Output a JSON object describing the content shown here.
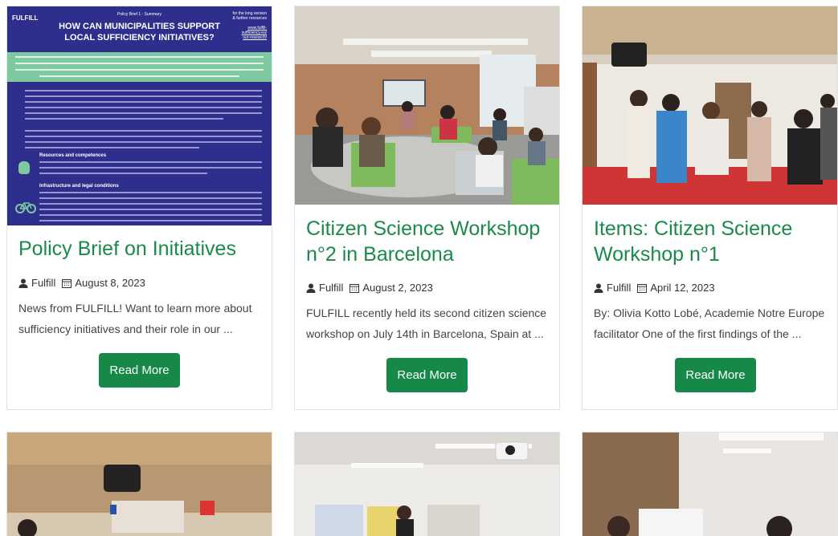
{
  "cards": [
    {
      "title": "Policy Brief on Initiatives",
      "author": "Fulfill",
      "date": "August 8, 2023",
      "excerpt": "News from FULFILL! Want to learn more about sufficiency initiatives and their role in our ...",
      "button": "Read More",
      "image": {
        "logo": "FULFILL",
        "subtitle": "Policy Brief 1 - Summary",
        "heading_line1": "HOW CAN MUNICIPALITIES SUPPORT",
        "heading_line2": "LOCAL SUFFICIENCY INITIATIVES?",
        "link_line1": "for the long version",
        "link_line2": "& further resources",
        "link_line3": "www.fulfill-",
        "link_line4": "sufficiency.eu/",
        "link_line5": "our-research/",
        "section1": "Resources and competences",
        "section2": "Infrastructure and legal conditions"
      }
    },
    {
      "title": "Citizen Science Workshop n°2 in Barcelona",
      "author": "Fulfill",
      "date": "August 2, 2023",
      "excerpt": "FULFILL recently held its second citizen science workshop on July 14th in Barcelona, Spain at ...",
      "button": "Read More"
    },
    {
      "title": "Items: Citizen Science Workshop n°1",
      "author": "Fulfill",
      "date": "April 12, 2023",
      "excerpt": "By: Olivia Kotto Lobé, Academie Notre Europe facilitator One of the first findings of the ...",
      "button": "Read More"
    }
  ],
  "colors": {
    "title": "#1a8a4a",
    "button": "#168848"
  }
}
